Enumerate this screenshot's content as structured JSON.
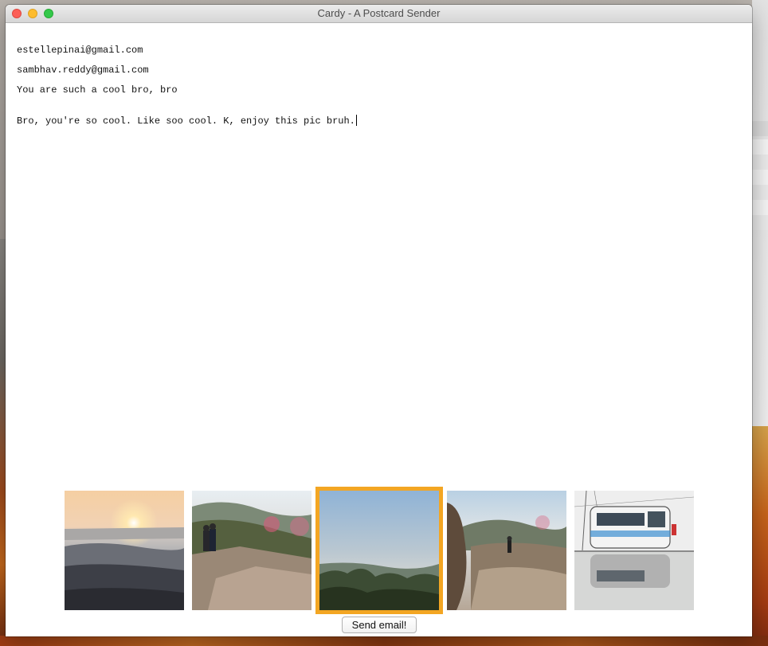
{
  "window": {
    "title": "Cardy - A Postcard Sender"
  },
  "form": {
    "from_email": "estellepinai@gmail.com",
    "to_email": "sambhav.reddy@gmail.com",
    "subject": "You are such a cool bro, bro",
    "message": "Bro, you're so cool. Like soo cool. K, enjoy this pic bruh."
  },
  "photos": [
    {
      "name": "sunset-over-bay",
      "selected": false
    },
    {
      "name": "couple-on-hill",
      "selected": false
    },
    {
      "name": "hazy-valley-view",
      "selected": true
    },
    {
      "name": "hiker-on-rocks",
      "selected": false
    },
    {
      "name": "flooded-bus",
      "selected": false
    }
  ],
  "actions": {
    "send_label": "Send email!"
  },
  "colors": {
    "selection_border": "#f3a623",
    "close": "#fc5f57",
    "minimize": "#fdbc2e",
    "maximize": "#34c84a"
  }
}
